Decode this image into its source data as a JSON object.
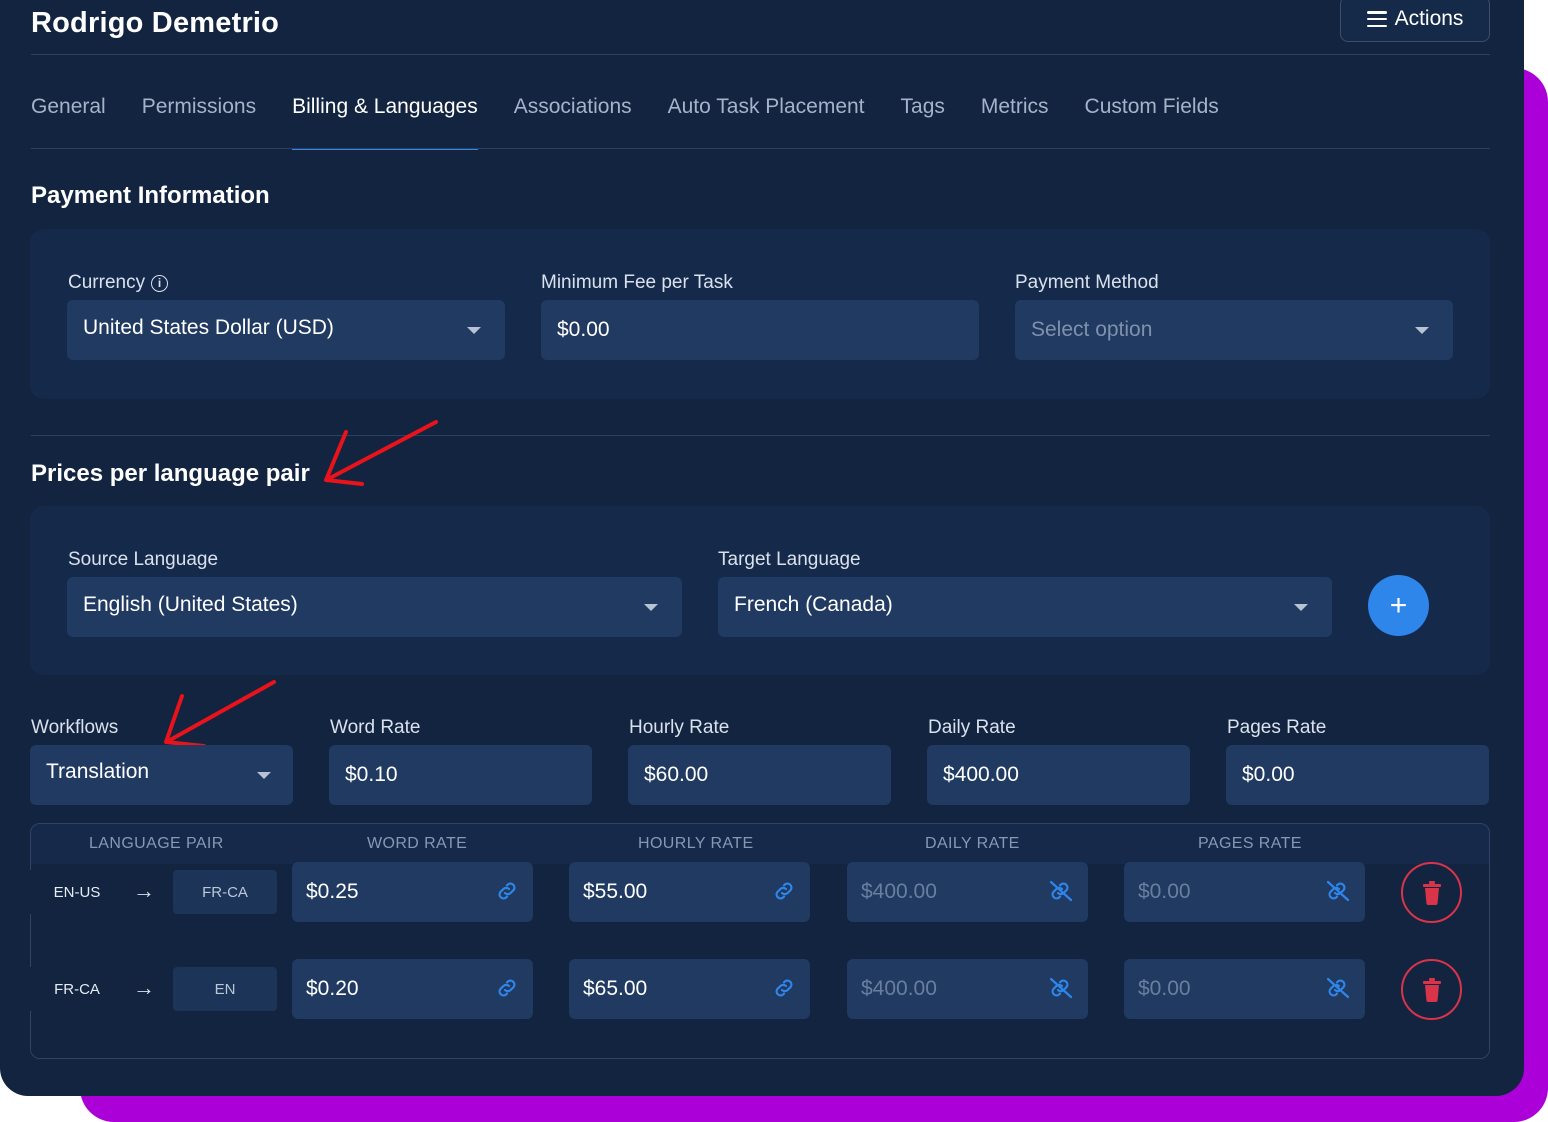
{
  "header": {
    "title": "Rodrigo Demetrio",
    "actions_label": "Actions"
  },
  "tabs": [
    {
      "label": "General",
      "active": false
    },
    {
      "label": "Permissions",
      "active": false
    },
    {
      "label": "Billing & Languages",
      "active": true
    },
    {
      "label": "Associations",
      "active": false
    },
    {
      "label": "Auto Task Placement",
      "active": false
    },
    {
      "label": "Tags",
      "active": false
    },
    {
      "label": "Metrics",
      "active": false
    },
    {
      "label": "Custom Fields",
      "active": false
    }
  ],
  "payment": {
    "title": "Payment Information",
    "currency_label": "Currency",
    "currency_value": "United States Dollar (USD)",
    "min_fee_label": "Minimum Fee per Task",
    "min_fee_value": "$0.00",
    "method_label": "Payment Method",
    "method_placeholder": "Select option"
  },
  "prices": {
    "title": "Prices per language pair",
    "source_label": "Source Language",
    "source_value": "English (United States)",
    "target_label": "Target Language",
    "target_value": "French (Canada)",
    "add_label": "+"
  },
  "rates": {
    "workflows_label": "Workflows",
    "workflows_value": "Translation",
    "word_label": "Word Rate",
    "word_value": "$0.10",
    "hourly_label": "Hourly Rate",
    "hourly_value": "$60.00",
    "daily_label": "Daily Rate",
    "daily_value": "$400.00",
    "pages_label": "Pages Rate",
    "pages_value": "$0.00"
  },
  "table": {
    "headers": [
      "LANGUAGE PAIR",
      "WORD RATE",
      "HOURLY RATE",
      "DAILY RATE",
      "PAGES RATE"
    ],
    "rows": [
      {
        "source": "EN-US",
        "target": "FR-CA",
        "word": "$0.25",
        "hourly": "$55.00",
        "daily": "$400.00",
        "pages": "$0.00"
      },
      {
        "source": "FR-CA",
        "target": "EN",
        "word": "$0.20",
        "hourly": "$65.00",
        "daily": "$400.00",
        "pages": "$0.00"
      }
    ]
  },
  "colors": {
    "panel": "#12243f",
    "card": "#15294a",
    "field": "#203a61",
    "accent": "#2f86ea",
    "danger": "#d9344a",
    "frame": "#ac00d9",
    "annotation": "#e8131b"
  },
  "icons": [
    "hamburger-icon",
    "info-icon",
    "chevron-down-icon",
    "plus-icon",
    "arrow-right-icon",
    "link-icon",
    "unlink-icon",
    "trash-icon",
    "red-arrow-annotation"
  ]
}
